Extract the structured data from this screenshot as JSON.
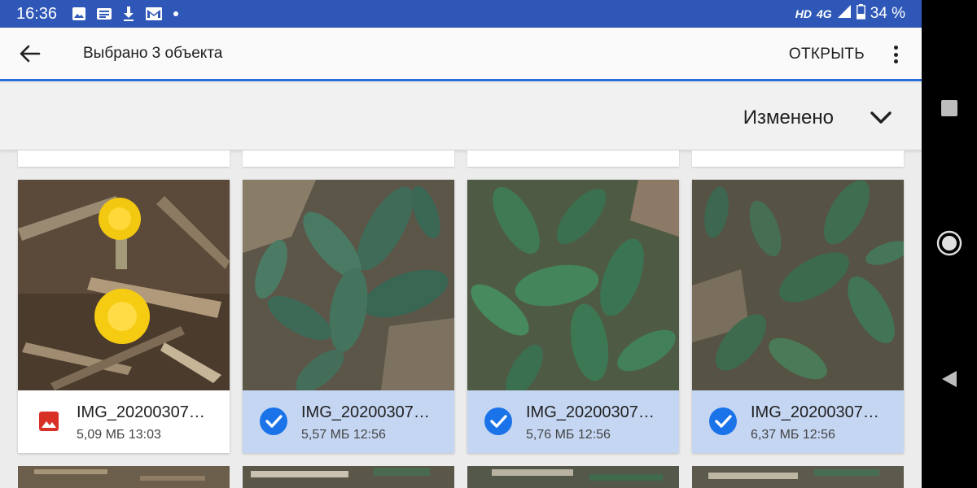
{
  "status_bar": {
    "time": "16:36",
    "notifications": [
      "image-icon",
      "news-icon",
      "download-icon",
      "gmail-icon",
      "dot-icon"
    ],
    "network_badge": "HD",
    "network": "4G",
    "battery": "34 %"
  },
  "app_bar": {
    "title": "Выбрано 3 объекта",
    "open_label": "ОТКРЫТЬ"
  },
  "sort_bar": {
    "label": "Изменено"
  },
  "files": [
    {
      "name": "IMG_20200307…",
      "size": "5,09 МБ",
      "time": "13:03",
      "selected": false,
      "icon": "image-file-icon"
    },
    {
      "name": "IMG_20200307…",
      "size": "5,57 МБ",
      "time": "12:56",
      "selected": true,
      "icon": "check-circle-icon"
    },
    {
      "name": "IMG_20200307…",
      "size": "5,76 МБ",
      "time": "12:56",
      "selected": true,
      "icon": "check-circle-icon"
    },
    {
      "name": "IMG_20200307…",
      "size": "6,37 МБ",
      "time": "12:56",
      "selected": true,
      "icon": "check-circle-icon"
    }
  ],
  "colors": {
    "status_bar": "#2e57b7",
    "accent": "#2a6fd8",
    "selected_bg": "#c5d6f3",
    "check": "#1a73e8",
    "image_icon": "#d93025"
  }
}
